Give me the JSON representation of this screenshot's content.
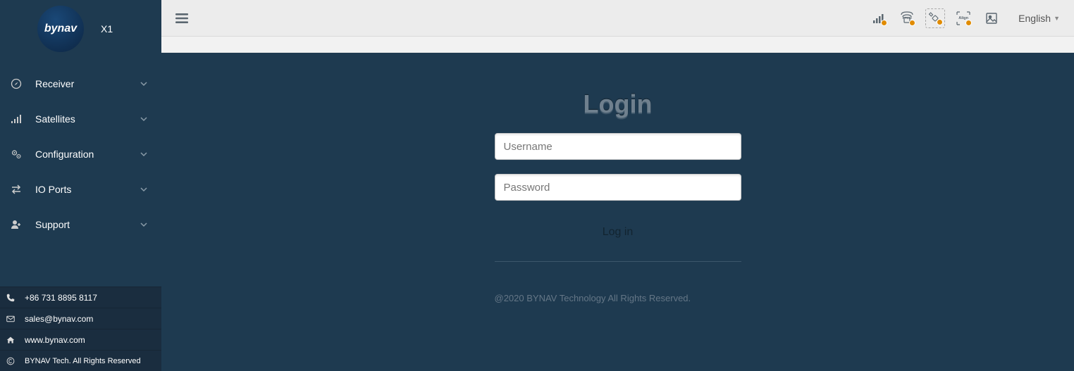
{
  "brand": {
    "logo_text": "bynav",
    "product": "X1"
  },
  "sidebar": {
    "items": [
      {
        "label": "Receiver"
      },
      {
        "label": "Satellites"
      },
      {
        "label": "Configuration"
      },
      {
        "label": "IO Ports"
      },
      {
        "label": "Support"
      }
    ]
  },
  "footer": {
    "phone": "+86 731 8895 8117",
    "email": "sales@bynav.com",
    "website": "www.bynav.com",
    "copyright": "BYNAV Tech. All Rights Reserved"
  },
  "topbar": {
    "language": "English",
    "status_icons": [
      "signal",
      "rtcm",
      "satellite",
      "align",
      "image"
    ]
  },
  "login": {
    "title": "Login",
    "username_placeholder": "Username",
    "password_placeholder": "Password",
    "submit_label": "Log in"
  },
  "page_copyright": "@2020 BYNAV Technology All Rights Reserved."
}
